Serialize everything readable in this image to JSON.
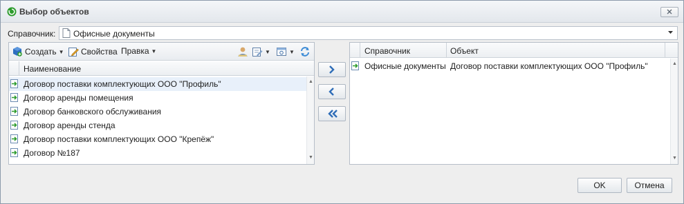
{
  "window": {
    "title": "Выбор объектов"
  },
  "sprav": {
    "label": "Справочник:",
    "value": "Офисные документы"
  },
  "toolbar": {
    "create_label": "Создать",
    "properties_label": "Свойства",
    "edit_label": "Правка"
  },
  "left_grid": {
    "column": "Наименование",
    "rows": [
      "Договор поставки комплектующих ООО \"Профиль\"",
      "Договор аренды помещения",
      "Договор банковского обслуживания",
      "Договор аренды стенда",
      "Договор поставки комплектующих ООО \"Крепёж\"",
      "Договор №187"
    ]
  },
  "right_grid": {
    "columns": [
      "Справочник",
      "Объект"
    ],
    "rows": [
      {
        "sprav": "Офисные документы",
        "object": "Договор поставки комплектующих ООО \"Профиль\""
      }
    ]
  },
  "buttons": {
    "ok": "OK",
    "cancel": "Отмена"
  },
  "icons": {
    "app": "refresh-circle-icon",
    "close": "close-icon",
    "document": "document-icon",
    "create": "create-icon",
    "properties": "properties-icon",
    "user": "user-icon",
    "filter": "filter-icon",
    "view": "view-icon",
    "refresh": "refresh-icon",
    "row_object": "object-arrow-icon"
  }
}
